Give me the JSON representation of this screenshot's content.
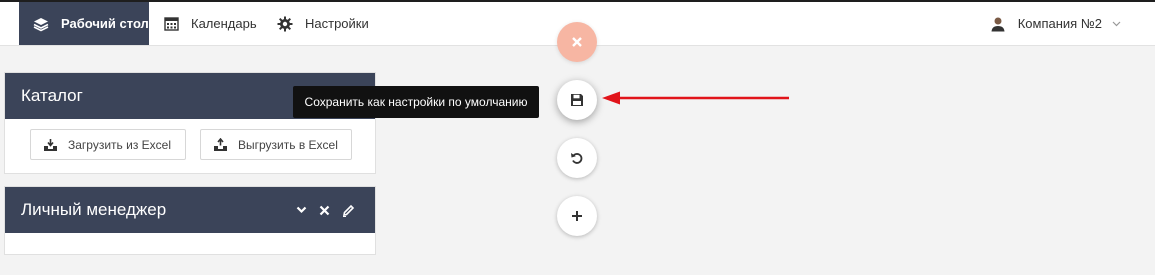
{
  "nav": {
    "items": [
      {
        "label": "Рабочий стол",
        "icon": "layers-icon",
        "active": true
      },
      {
        "label": "Календарь",
        "icon": "calendar-icon",
        "active": false
      },
      {
        "label": "Настройки",
        "icon": "gear-icon",
        "active": false
      }
    ],
    "company": {
      "label": "Компания №2",
      "icon": "user-icon",
      "chevron": "chevron-down-icon"
    }
  },
  "widgets": {
    "catalog": {
      "title": "Каталог",
      "buttons": [
        {
          "label": "Загрузить из Excel",
          "icon": "upload-tray-icon"
        },
        {
          "label": "Выгрузить в Excel",
          "icon": "download-tray-icon"
        }
      ]
    },
    "manager": {
      "title": "Личный менеджер",
      "tools": [
        "chevron-down-icon",
        "close-icon",
        "pencil-icon"
      ]
    }
  },
  "fab": {
    "buttons": [
      "close-icon",
      "save-icon",
      "undo-icon",
      "plus-icon"
    ],
    "tooltip": "Сохранить как настройки по умолчанию"
  },
  "colors": {
    "accent": "#3b4459",
    "fab_close": "#f7b6a3",
    "arrow": "#e1141a",
    "tooltip_bg": "#111111"
  }
}
